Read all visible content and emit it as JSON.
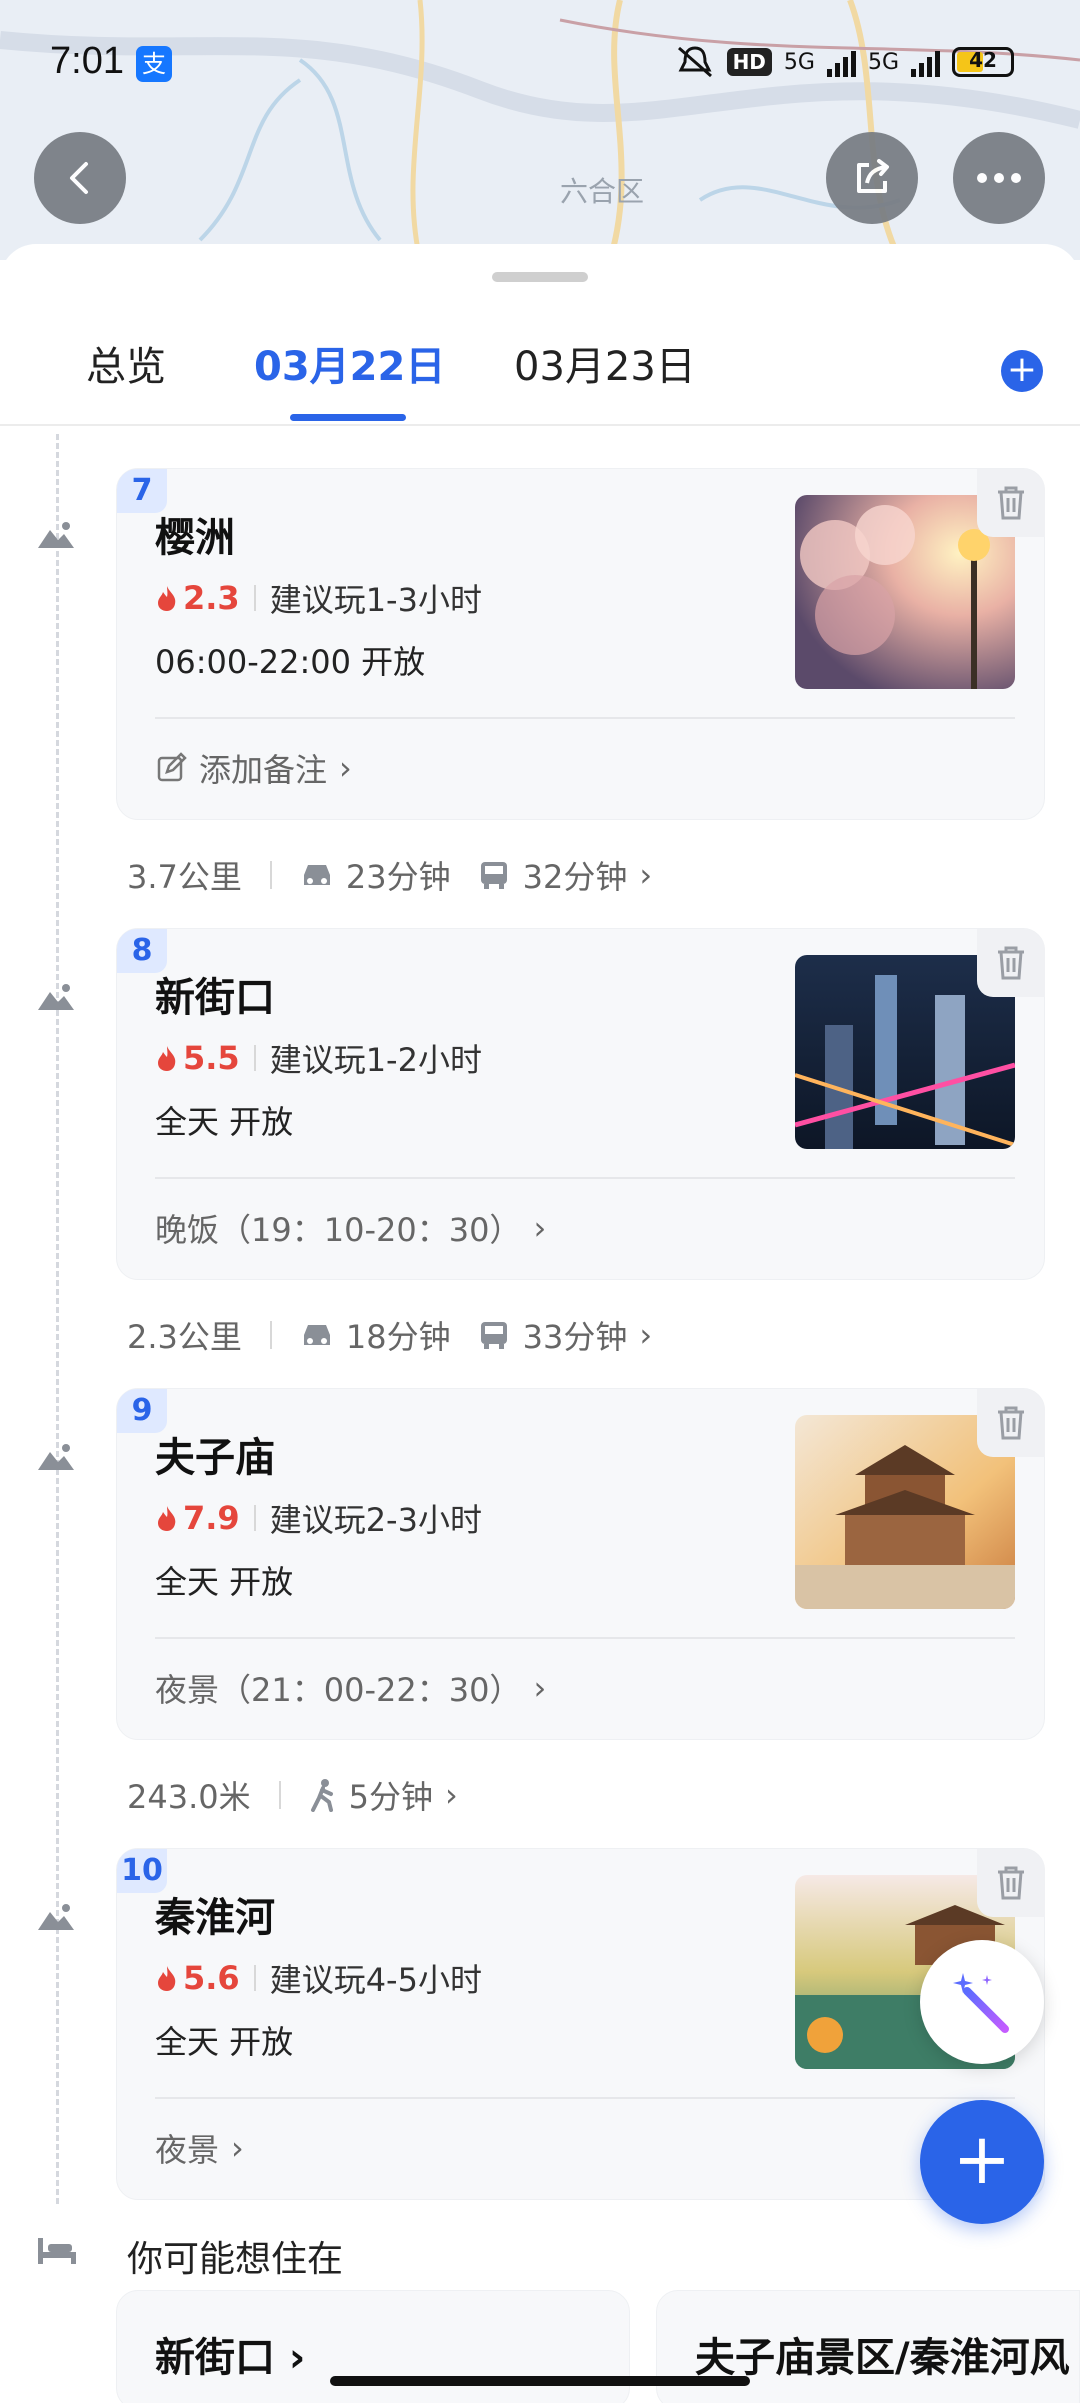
{
  "status_bar": {
    "time": "7:01",
    "alipay_icon_text": "支",
    "hd_label": "HD",
    "network_1": "5G",
    "network_2": "5G",
    "battery": "42"
  },
  "map": {
    "label": "六合区"
  },
  "tabs": [
    {
      "label": "总览",
      "active": false
    },
    {
      "label": "03月22日",
      "active": true
    },
    {
      "label": "03月23日",
      "active": false
    }
  ],
  "stops": [
    {
      "index": "7",
      "name": "樱洲",
      "heat": "2.3",
      "suggest": "建议玩1-3小时",
      "hours": "06:00-22:00 开放",
      "note": "添加备注",
      "photo_kind": "cherry"
    },
    {
      "index": "8",
      "name": "新街口",
      "heat": "5.5",
      "suggest": "建议玩1-2小时",
      "hours": "全天 开放",
      "note": "晚饭（19：10-20：30）",
      "photo_kind": "city"
    },
    {
      "index": "9",
      "name": "夫子庙",
      "heat": "7.9",
      "suggest": "建议玩2-3小时",
      "hours": "全天 开放",
      "note": "夜景（21：00-22：30）",
      "photo_kind": "temple"
    },
    {
      "index": "10",
      "name": "秦淮河",
      "heat": "5.6",
      "suggest": "建议玩4-5小时",
      "hours": "全天 开放",
      "note": "夜景",
      "photo_kind": "river"
    }
  ],
  "transits": [
    {
      "distance": "3.7公里",
      "car": "23分钟",
      "bus": "32分钟"
    },
    {
      "distance": "2.3公里",
      "car": "18分钟",
      "bus": "33分钟"
    },
    {
      "distance": "243.0米",
      "walk": "5分钟"
    }
  ],
  "stay": {
    "title": "你可能想住在",
    "options": [
      "新街口 ›",
      "夫子庙景区/秦淮河风"
    ]
  },
  "colors": {
    "accent": "#2a64e8",
    "heat": "#e5463c"
  }
}
